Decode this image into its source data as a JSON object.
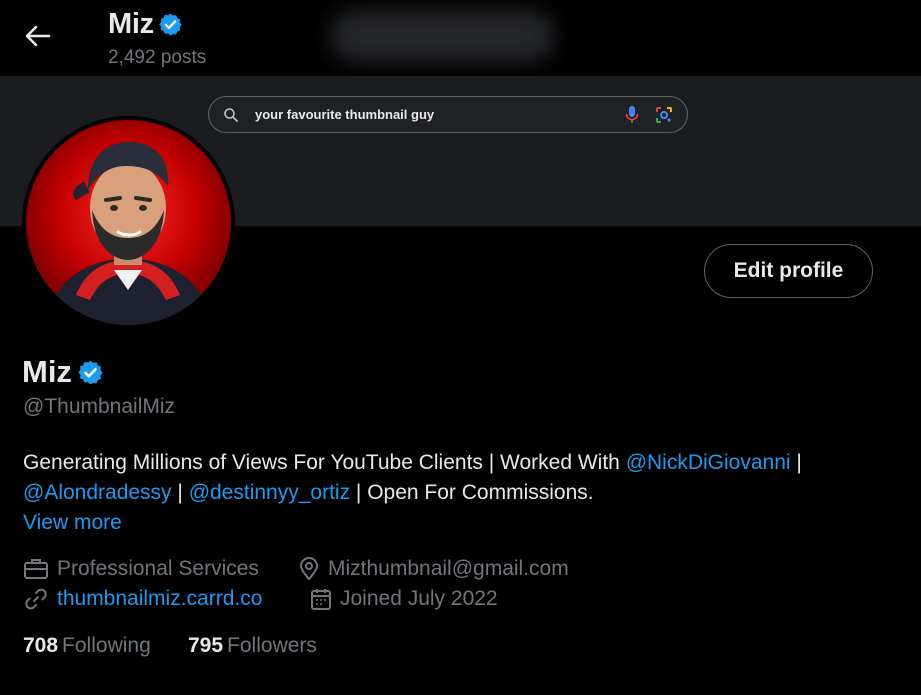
{
  "header": {
    "name": "Miz",
    "posts": "2,492 posts"
  },
  "search": {
    "query": "your favourite thumbnail guy"
  },
  "profile": {
    "edit_label": "Edit profile",
    "name": "Miz",
    "handle": "@ThumbnailMiz",
    "bio": {
      "part1": "Generating Millions of Views For YouTube Clients | Worked With ",
      "mention1": "@NickDiGiovanni",
      "sep1": " |",
      "mention2": "@Alondradessy",
      "sep2": " | ",
      "mention3": "@destinnyy_ortiz",
      "part2": " | Open For Commissions."
    },
    "view_more": "View more",
    "category": "Professional Services",
    "location": "Mizthumbnail@gmail.com",
    "website": "thumbnailmiz.carrd.co",
    "joined": "Joined July 2022",
    "following_count": "708",
    "following_label": "Following",
    "followers_count": "795",
    "followers_label": "Followers"
  },
  "colors": {
    "accent": "#1d9bf0",
    "muted": "#71767b",
    "text": "#e7e9ea",
    "background": "#000000",
    "banner": "#1b1c20"
  },
  "icons": {
    "back": "arrow-left-icon",
    "verified": "verified-badge-icon",
    "search": "search-icon",
    "mic": "microphone-icon",
    "lens": "camera-lens-icon",
    "category": "briefcase-icon",
    "location": "location-pin-icon",
    "website": "link-icon",
    "joined": "calendar-icon"
  }
}
